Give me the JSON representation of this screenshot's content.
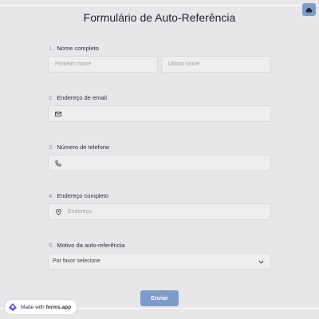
{
  "form": {
    "title": "Formulário de Auto-Referência",
    "questions": [
      {
        "number": "1.",
        "label": "Nome completo",
        "first_placeholder": "Primeiro nome",
        "last_placeholder": "Último nome"
      },
      {
        "number": "2.",
        "label": "Endereço de email",
        "icon": "envelope-icon"
      },
      {
        "number": "3.",
        "label": "Número de telefone",
        "icon": "phone-icon"
      },
      {
        "number": "4.",
        "label": "Endereço completo",
        "icon": "location-pin-icon",
        "placeholder": "Endereço"
      },
      {
        "number": "5.",
        "label": "Motivo da auto-referência",
        "selected": "Por favor selecione",
        "icon": "chevron-down-icon"
      }
    ],
    "submit_label": "Enviar"
  },
  "branding": {
    "prefix": "Made with",
    "brand": "forms.app"
  },
  "colors": {
    "accent": "#7c9ccc",
    "background": "#e7e7e9",
    "field": "#eeeeef"
  },
  "top_right": {
    "icon": "cloud-icon"
  }
}
